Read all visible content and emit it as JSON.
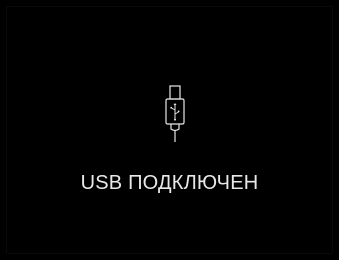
{
  "screen": {
    "background": "#000000",
    "icon": "usb-cable-icon",
    "status_text": "USB ПОДКЛЮЧЕН",
    "text_color": "#e8e8e8"
  }
}
